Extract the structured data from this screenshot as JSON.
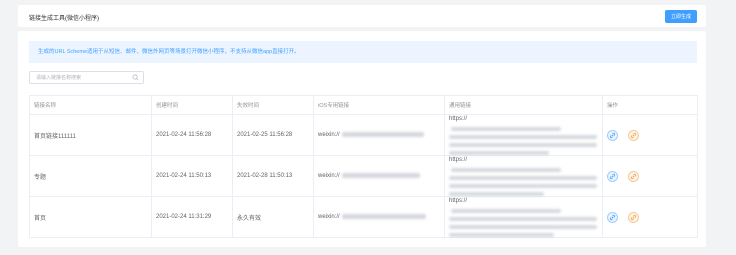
{
  "header": {
    "title": "链接生成工具(微信小程序)",
    "generate_button": "立即生成"
  },
  "notice": "生成的URL Scheme适用于从短信、邮件、微信外网页等场景打开微信小程序，不支持从微信app直接打开。",
  "search": {
    "placeholder": "请输入链接名称搜索"
  },
  "table": {
    "columns": [
      "链接名称",
      "创建时间",
      "失效时间",
      "iOS专用链接",
      "通用链接",
      "操作"
    ],
    "rows": [
      {
        "name": "首页链接111111",
        "created": "2021-02-24 11:56:28",
        "expires": "2021-02-25 11:56:28",
        "ios_prefix": "weixin://",
        "universal_prefix": "https://"
      },
      {
        "name": "专题",
        "created": "2021-02-24 11:50:13",
        "expires": "2021-02-28 11:50:13",
        "ios_prefix": "weixin://",
        "universal_prefix": "https://"
      },
      {
        "name": "首页",
        "created": "2021-02-24 11:31:29",
        "expires": "永久有效",
        "ios_prefix": "weixin://",
        "universal_prefix": "https://"
      }
    ]
  },
  "icons": {
    "search": "search-icon",
    "copy_ios": "link-icon",
    "copy_universal": "link-icon"
  },
  "colors": {
    "primary": "#409eff",
    "notice_bg": "#ecf5ff",
    "op_orange": "#f0a04b"
  }
}
